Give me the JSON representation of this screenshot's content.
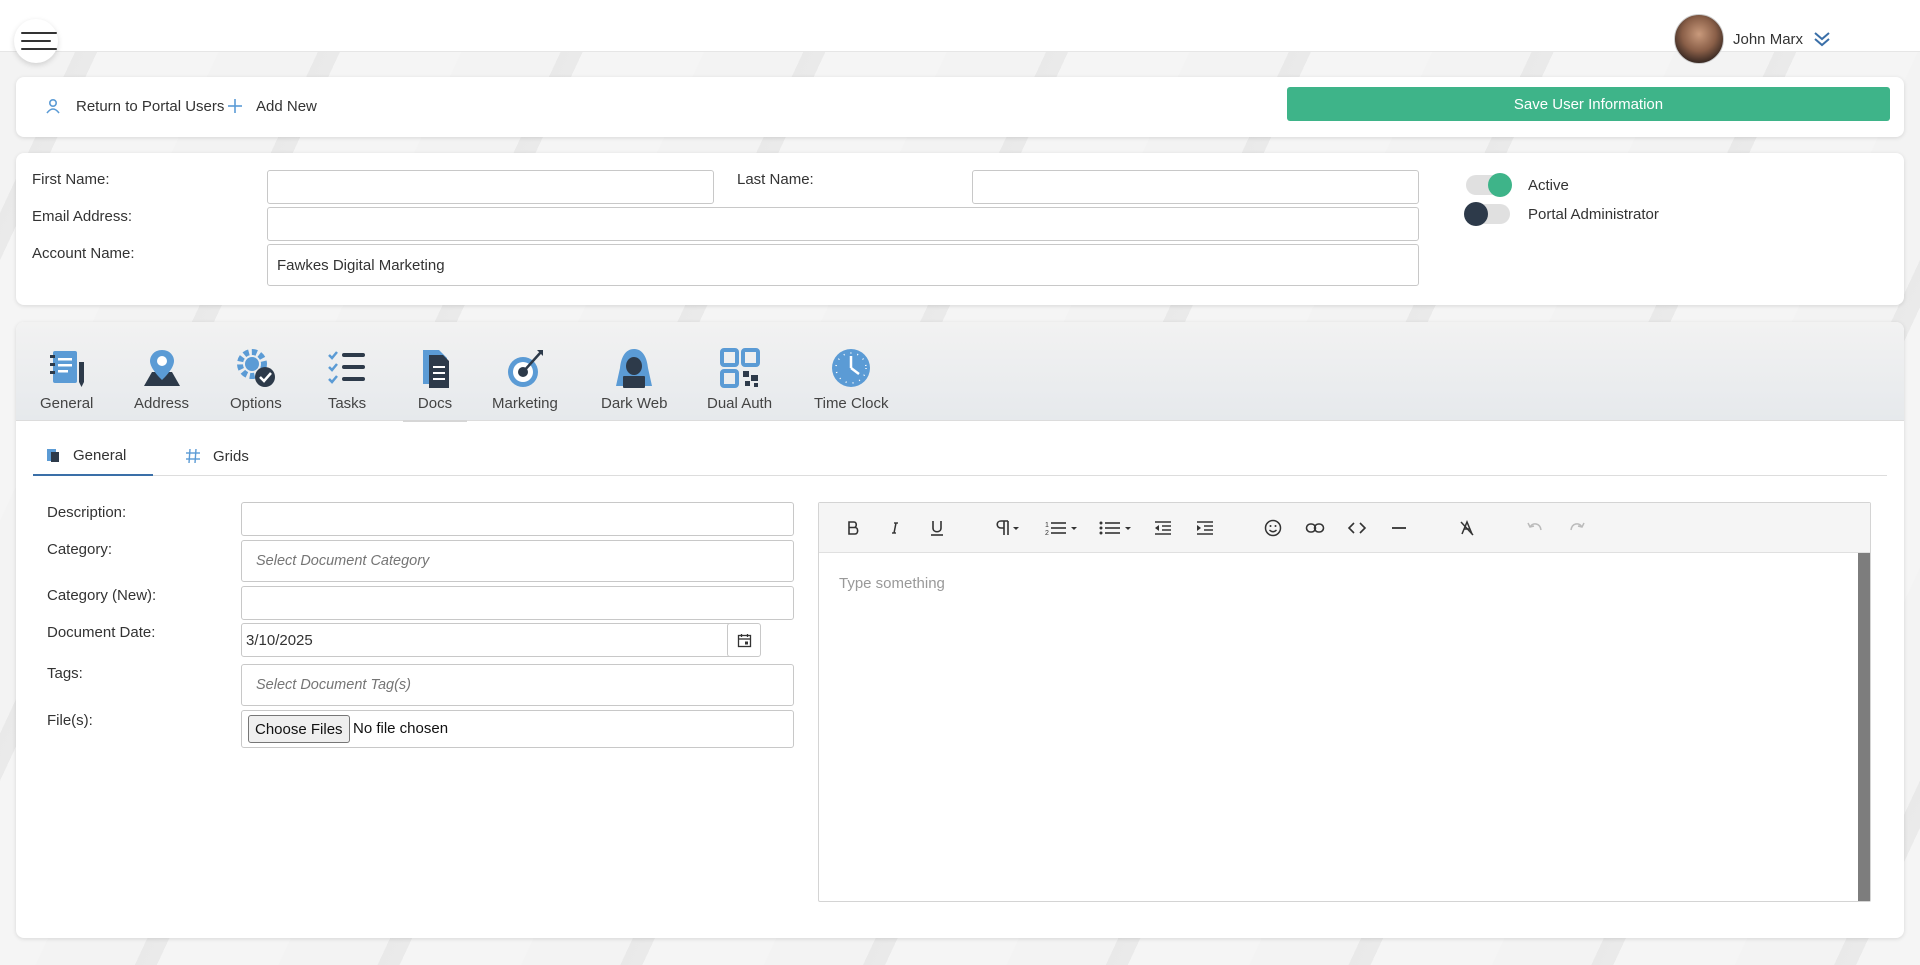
{
  "header": {
    "user_name": "John Marx",
    "menu_icon": "hamburger-menu-icon",
    "chevron_icon": "double-chevron-down-icon"
  },
  "actions": {
    "return_label": "Return to Portal Users",
    "add_new_label": "Add New",
    "save_label": "Save User Information",
    "save_color": "#3eb489"
  },
  "user_form": {
    "first_name_label": "First Name:",
    "first_name_value": "",
    "last_name_label": "Last Name:",
    "last_name_value": "",
    "email_label": "Email Address:",
    "email_value": "",
    "account_label": "Account Name:",
    "account_value": "Fawkes Digital Marketing",
    "active_label": "Active",
    "active_on": true,
    "admin_label": "Portal Administrator",
    "admin_on": false
  },
  "main_tabs": [
    {
      "label": "General",
      "icon": "notebook-pen-icon"
    },
    {
      "label": "Address",
      "icon": "map-pin-icon"
    },
    {
      "label": "Options",
      "icon": "gear-check-icon"
    },
    {
      "label": "Tasks",
      "icon": "checklist-icon"
    },
    {
      "label": "Docs",
      "icon": "document-icon",
      "active": true
    },
    {
      "label": "Marketing",
      "icon": "target-icon"
    },
    {
      "label": "Dark Web",
      "icon": "hacker-icon"
    },
    {
      "label": "Dual Auth",
      "icon": "qr-code-icon"
    },
    {
      "label": "Time Clock",
      "icon": "clock-icon"
    }
  ],
  "sub_tabs": [
    {
      "label": "General",
      "icon": "document-small-icon",
      "active": true
    },
    {
      "label": "Grids",
      "icon": "hash-icon"
    }
  ],
  "doc_form": {
    "description_label": "Description:",
    "description_value": "",
    "category_label": "Category:",
    "category_placeholder": "Select Document Category",
    "category_new_label": "Category (New):",
    "category_new_value": "",
    "date_label": "Document Date:",
    "date_value": "3/10/2025",
    "tags_label": "Tags:",
    "tags_placeholder": "Select Document Tag(s)",
    "files_label": "File(s):",
    "choose_files_label": "Choose Files",
    "no_file_label": "No file chosen"
  },
  "editor": {
    "placeholder": "Type something",
    "toolbar": [
      "bold-icon",
      "italic-icon",
      "underline-icon",
      "paragraph-icon",
      "ordered-list-icon",
      "unordered-list-icon",
      "outdent-icon",
      "indent-icon",
      "emoji-icon",
      "link-icon",
      "code-icon",
      "horizontal-rule-icon",
      "clear-format-icon",
      "undo-icon",
      "redo-icon"
    ]
  },
  "colors": {
    "accent_green": "#3eb489",
    "icon_blue": "#5b9bd5",
    "icon_dark": "#2d3a4a"
  }
}
